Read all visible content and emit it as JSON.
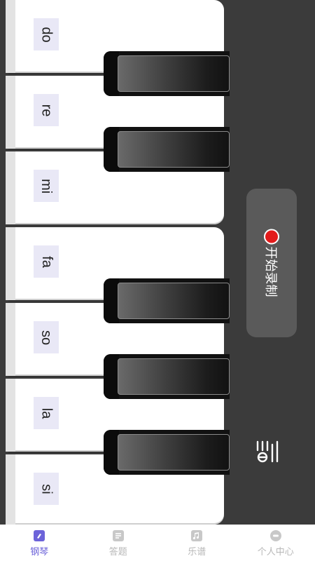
{
  "piano": {
    "white_keys": [
      {
        "note": "do"
      },
      {
        "note": "re"
      },
      {
        "note": "mi"
      },
      {
        "note": "fa"
      },
      {
        "note": "so"
      },
      {
        "note": "la"
      },
      {
        "note": "si"
      }
    ]
  },
  "record": {
    "label": "开始录制",
    "icon": "record-dot-icon",
    "dot_color": "#e21b1b"
  },
  "side_action": {
    "icon": "score-list-icon"
  },
  "tabbar": {
    "active_color": "#6c63d9",
    "inactive_color": "#b8b8b8",
    "tabs": [
      {
        "label": "钢琴",
        "icon": "piano-icon",
        "active": true
      },
      {
        "label": "答题",
        "icon": "quiz-icon",
        "active": false
      },
      {
        "label": "乐谱",
        "icon": "music-note-icon",
        "active": false
      },
      {
        "label": "个人中心",
        "icon": "profile-icon",
        "active": false
      }
    ]
  }
}
